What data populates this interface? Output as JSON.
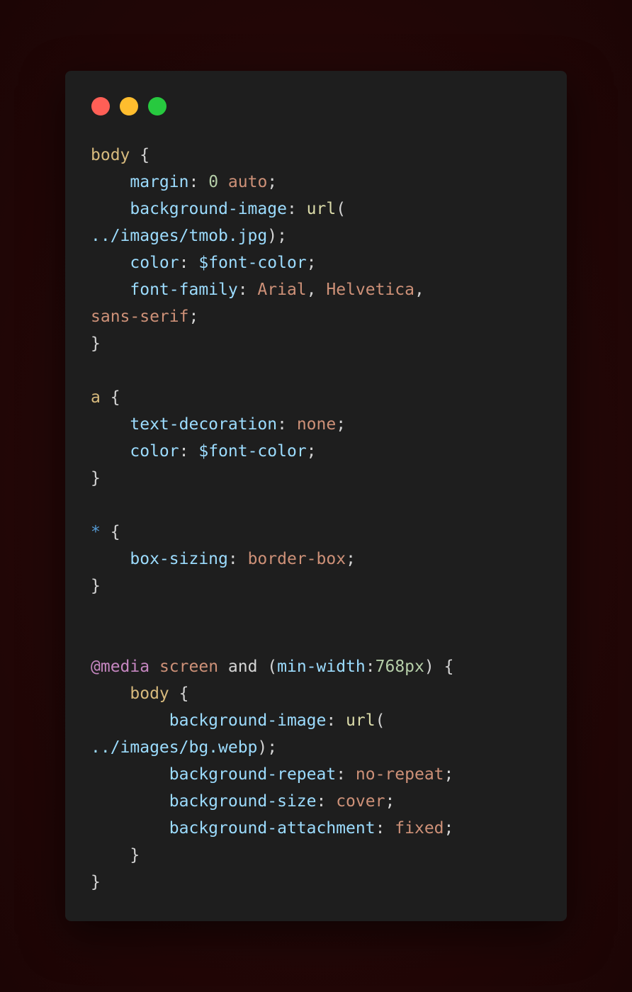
{
  "window": {
    "controls": [
      {
        "name": "close",
        "color": "#ff5f56"
      },
      {
        "name": "minimize",
        "color": "#ffbd2e"
      },
      {
        "name": "maximize",
        "color": "#27c93f"
      }
    ]
  },
  "colors": {
    "selector": "#d7ba7d",
    "property": "#9cdcfe",
    "number": "#b5cea8",
    "value": "#ce9178",
    "function": "#dcdcaa",
    "punctuation": "#d4d4d4",
    "at_rule": "#c586c0",
    "universal": "#569cd6"
  },
  "code_lines": [
    [
      {
        "t": "body",
        "c": "sel"
      },
      {
        "t": " {",
        "c": "punc"
      }
    ],
    [
      {
        "t": "    ",
        "c": "punc"
      },
      {
        "t": "margin",
        "c": "prop"
      },
      {
        "t": ": ",
        "c": "punc"
      },
      {
        "t": "0",
        "c": "num"
      },
      {
        "t": " ",
        "c": "punc"
      },
      {
        "t": "auto",
        "c": "val"
      },
      {
        "t": ";",
        "c": "punc"
      }
    ],
    [
      {
        "t": "    ",
        "c": "punc"
      },
      {
        "t": "background-image",
        "c": "prop"
      },
      {
        "t": ": ",
        "c": "punc"
      },
      {
        "t": "url",
        "c": "fn"
      },
      {
        "t": "(",
        "c": "punc"
      }
    ],
    [
      {
        "t": "../images/tmob.jpg",
        "c": "prop"
      },
      {
        "t": ");",
        "c": "punc"
      }
    ],
    [
      {
        "t": "    ",
        "c": "punc"
      },
      {
        "t": "color",
        "c": "prop"
      },
      {
        "t": ": ",
        "c": "punc"
      },
      {
        "t": "$font-color",
        "c": "prop"
      },
      {
        "t": ";",
        "c": "punc"
      }
    ],
    [
      {
        "t": "    ",
        "c": "punc"
      },
      {
        "t": "font-family",
        "c": "prop"
      },
      {
        "t": ": ",
        "c": "punc"
      },
      {
        "t": "Arial",
        "c": "val"
      },
      {
        "t": ", ",
        "c": "punc"
      },
      {
        "t": "Helvetica",
        "c": "val"
      },
      {
        "t": ",",
        "c": "punc"
      }
    ],
    [
      {
        "t": "sans-serif",
        "c": "val"
      },
      {
        "t": ";",
        "c": "punc"
      }
    ],
    [
      {
        "t": "}",
        "c": "punc"
      }
    ],
    [],
    [
      {
        "t": "a",
        "c": "sel"
      },
      {
        "t": " {",
        "c": "punc"
      }
    ],
    [
      {
        "t": "    ",
        "c": "punc"
      },
      {
        "t": "text-decoration",
        "c": "prop"
      },
      {
        "t": ": ",
        "c": "punc"
      },
      {
        "t": "none",
        "c": "val"
      },
      {
        "t": ";",
        "c": "punc"
      }
    ],
    [
      {
        "t": "    ",
        "c": "punc"
      },
      {
        "t": "color",
        "c": "prop"
      },
      {
        "t": ": ",
        "c": "punc"
      },
      {
        "t": "$font-color",
        "c": "prop"
      },
      {
        "t": ";",
        "c": "punc"
      }
    ],
    [
      {
        "t": "}",
        "c": "punc"
      }
    ],
    [],
    [
      {
        "t": "*",
        "c": "star"
      },
      {
        "t": " {",
        "c": "punc"
      }
    ],
    [
      {
        "t": "    ",
        "c": "punc"
      },
      {
        "t": "box-sizing",
        "c": "prop"
      },
      {
        "t": ": ",
        "c": "punc"
      },
      {
        "t": "border-box",
        "c": "val"
      },
      {
        "t": ";",
        "c": "punc"
      }
    ],
    [
      {
        "t": "}",
        "c": "punc"
      }
    ],
    [],
    [],
    [
      {
        "t": "@media",
        "c": "at"
      },
      {
        "t": " ",
        "c": "punc"
      },
      {
        "t": "screen",
        "c": "val"
      },
      {
        "t": " and (",
        "c": "kw"
      },
      {
        "t": "min-width",
        "c": "prop"
      },
      {
        "t": ":",
        "c": "punc"
      },
      {
        "t": "768px",
        "c": "num"
      },
      {
        "t": ") {",
        "c": "punc"
      }
    ],
    [
      {
        "t": "    ",
        "c": "punc"
      },
      {
        "t": "body",
        "c": "sel"
      },
      {
        "t": " {",
        "c": "punc"
      }
    ],
    [
      {
        "t": "        ",
        "c": "punc"
      },
      {
        "t": "background-image",
        "c": "prop"
      },
      {
        "t": ": ",
        "c": "punc"
      },
      {
        "t": "url",
        "c": "fn"
      },
      {
        "t": "(",
        "c": "punc"
      }
    ],
    [
      {
        "t": "../images/bg.webp",
        "c": "prop"
      },
      {
        "t": ");",
        "c": "punc"
      }
    ],
    [
      {
        "t": "        ",
        "c": "punc"
      },
      {
        "t": "background-repeat",
        "c": "prop"
      },
      {
        "t": ": ",
        "c": "punc"
      },
      {
        "t": "no-repeat",
        "c": "val"
      },
      {
        "t": ";",
        "c": "punc"
      }
    ],
    [
      {
        "t": "        ",
        "c": "punc"
      },
      {
        "t": "background-size",
        "c": "prop"
      },
      {
        "t": ": ",
        "c": "punc"
      },
      {
        "t": "cover",
        "c": "val"
      },
      {
        "t": ";",
        "c": "punc"
      }
    ],
    [
      {
        "t": "        ",
        "c": "punc"
      },
      {
        "t": "background-attachment",
        "c": "prop"
      },
      {
        "t": ": ",
        "c": "punc"
      },
      {
        "t": "fixed",
        "c": "val"
      },
      {
        "t": ";",
        "c": "punc"
      }
    ],
    [
      {
        "t": "    ",
        "c": "punc"
      },
      {
        "t": "}",
        "c": "punc"
      }
    ],
    [
      {
        "t": "}",
        "c": "punc"
      }
    ]
  ]
}
